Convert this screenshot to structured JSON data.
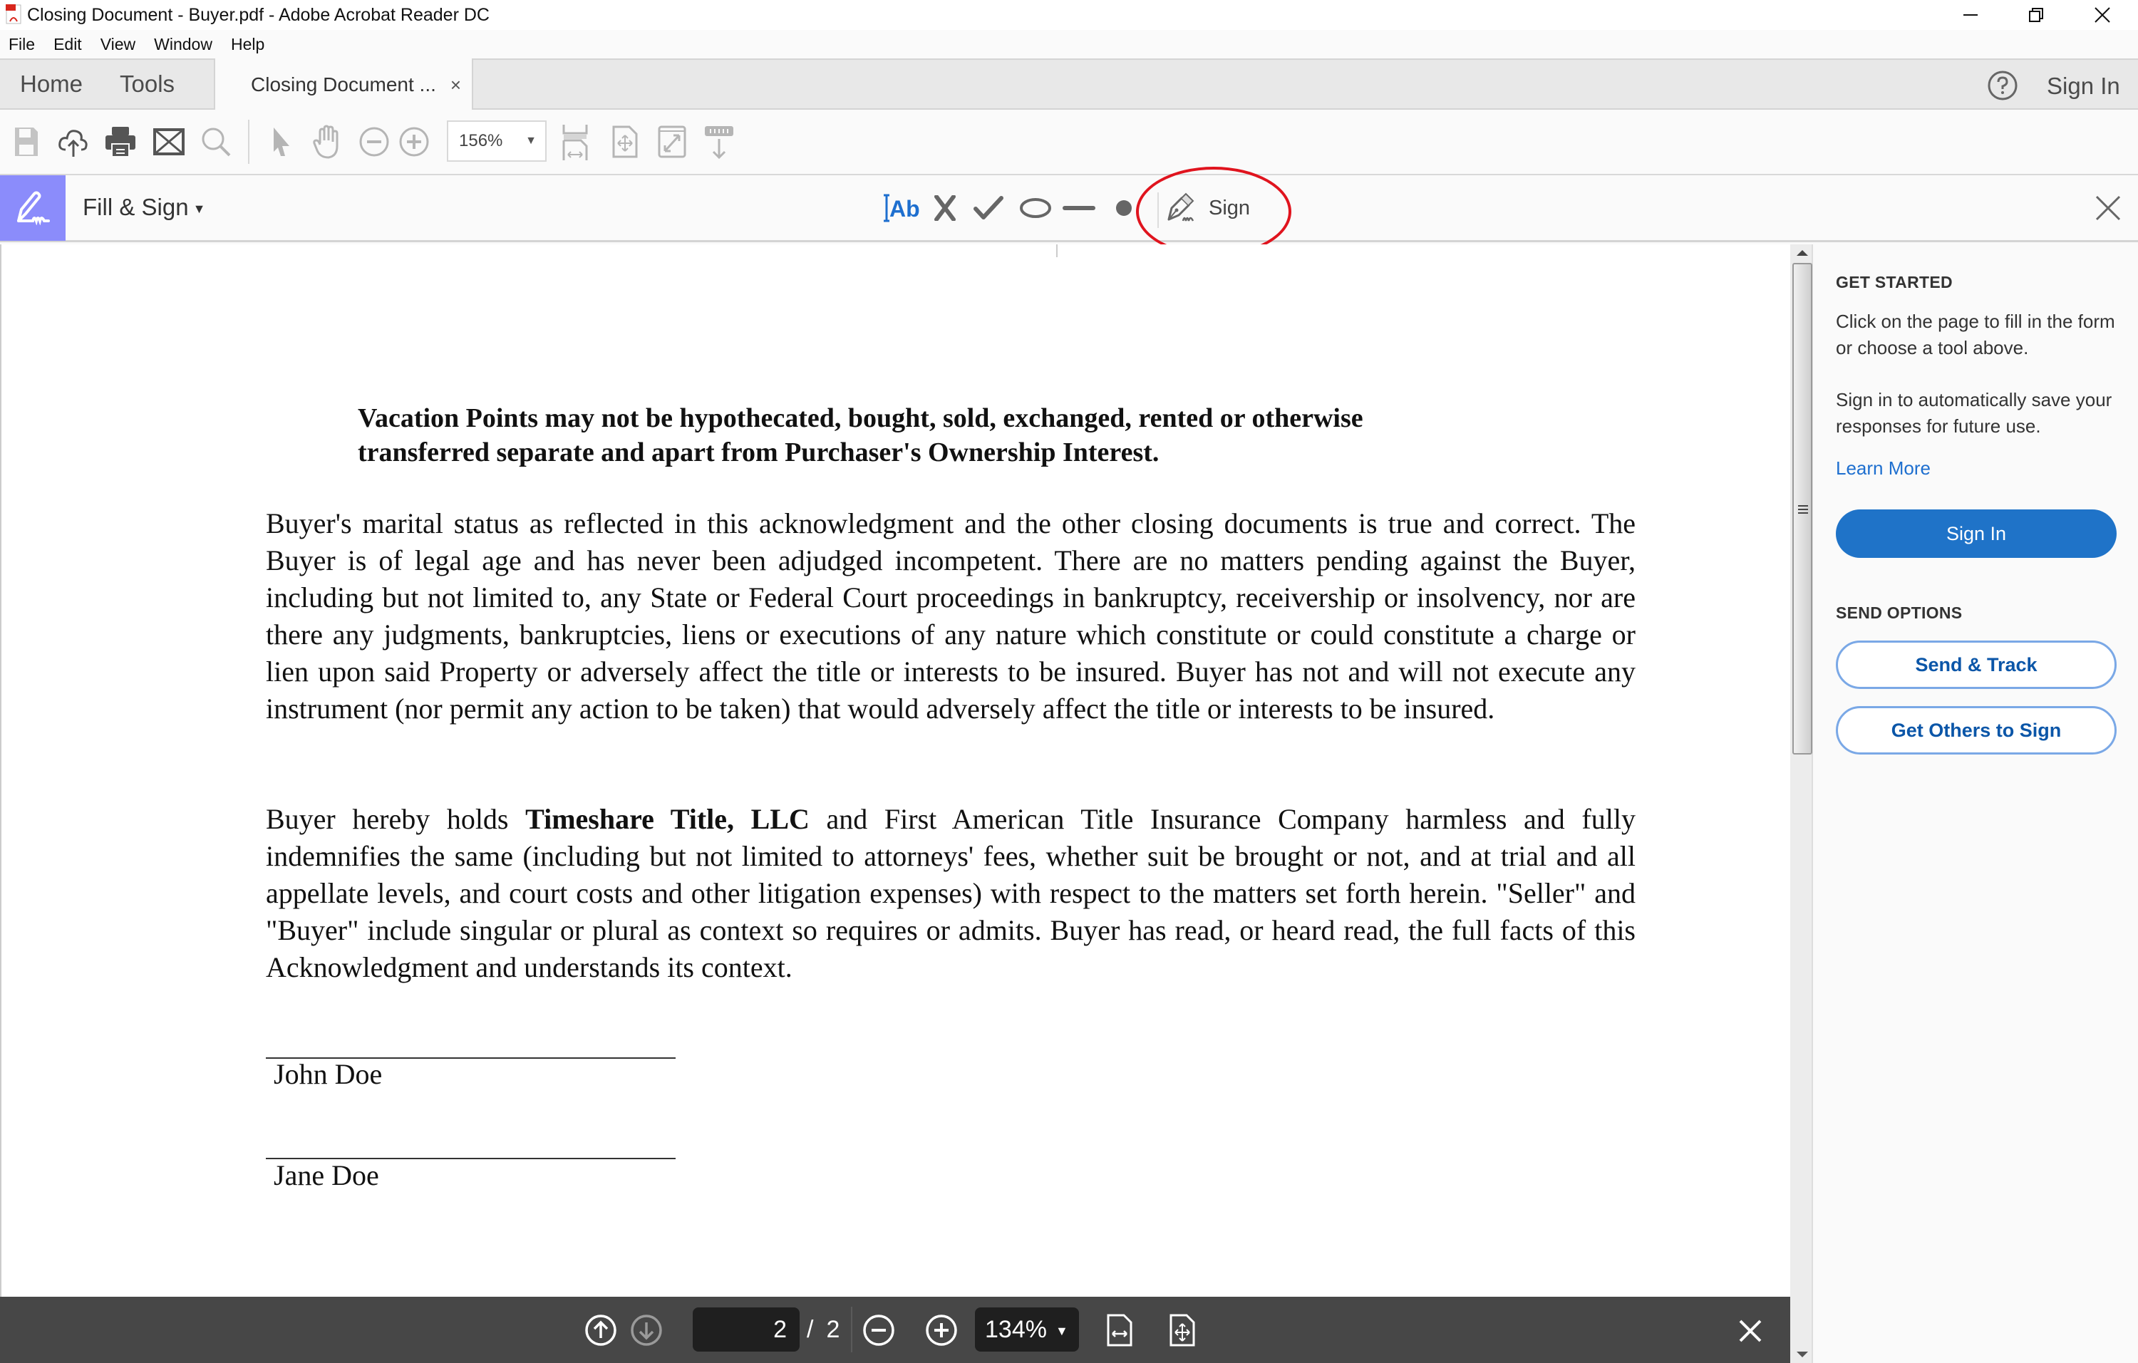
{
  "window": {
    "title": "Closing Document - Buyer.pdf - Adobe Acrobat Reader DC",
    "controls": [
      "minimize",
      "restore",
      "close"
    ]
  },
  "menubar": {
    "items": [
      "File",
      "Edit",
      "View",
      "Window",
      "Help"
    ]
  },
  "tabs": {
    "home": "Home",
    "tools": "Tools",
    "document": "Closing Document ...",
    "document_close": "×",
    "sign_in": "Sign In"
  },
  "toolbar": {
    "icons": [
      "save-icon",
      "cloud-upload-icon",
      "print-icon",
      "email-icon",
      "search-icon",
      "select-pointer-icon",
      "hand-pan-icon",
      "zoom-out-icon",
      "zoom-in-icon",
      "fit-width-icon",
      "fit-page-icon",
      "full-screen-icon",
      "read-mode-icon"
    ],
    "zoom_value": "156%"
  },
  "fill_sign": {
    "title": "Fill & Sign",
    "tools": [
      {
        "name": "add-text",
        "label": "Ab"
      },
      {
        "name": "cross-mark",
        "label": "X"
      },
      {
        "name": "check-mark",
        "label": "check"
      },
      {
        "name": "circle",
        "label": "circle"
      },
      {
        "name": "line",
        "label": "line"
      },
      {
        "name": "dot",
        "label": "dot"
      }
    ],
    "sign_label": "Sign",
    "accent_color": "#8b8cfb",
    "text_tool_color": "#1e6fcf",
    "highlight_annotation_color": "#e0141e"
  },
  "document": {
    "heading": "Vacation Points may not be hypothecated, bought, sold, exchanged, rented or otherwise transferred separate and apart from Purchaser's Ownership Interest.",
    "paragraph1": "Buyer's marital status as reflected in this acknowledgment and the other closing documents is true and correct. The Buyer is of legal age and has never been adjudged incompetent. There are no matters pending against the Buyer, including but not limited to, any State or Federal Court proceedings in bankruptcy, receivership or insolvency, nor are there any judgments, bankruptcies, liens or executions of any nature which constitute or could constitute a charge or lien upon said Property or adversely affect the title or interests to be insured. Buyer has not and will not execute any instrument (nor permit any action to be taken) that would adversely affect the title or interests to be insured.",
    "paragraph2_prefix": "Buyer hereby holds ",
    "paragraph2_bold": "Timeshare Title, LLC",
    "paragraph2_rest": " and First American Title Insurance Company harmless and fully indemnifies the same (including but not limited to attorneys' fees, whether suit be brought or not, and at trial and all appellate levels, and court costs and other litigation expenses) with respect to the matters set forth herein. \"Seller\" and \"Buyer\" include singular or plural as context so requires or admits. Buyer has read, or heard read, the full facts of this Acknowledgment and understands its context.",
    "signatories": [
      "John Doe",
      "Jane Doe"
    ]
  },
  "bottom_bar": {
    "current_page": "2",
    "total_pages": "2",
    "separator": "/",
    "zoom_value": "134%"
  },
  "right_panel": {
    "get_started_title": "GET STARTED",
    "get_started_text1": "Click on the page to fill in the form or choose a tool above.",
    "get_started_text2": "Sign in to automatically save your responses for future use.",
    "learn_more": "Learn More",
    "sign_in_button": "Sign In",
    "send_options_title": "SEND OPTIONS",
    "send_track_button": "Send & Track",
    "get_others_button": "Get Others to Sign",
    "primary_color": "#1f73c8",
    "link_color": "#1e6fcf"
  }
}
